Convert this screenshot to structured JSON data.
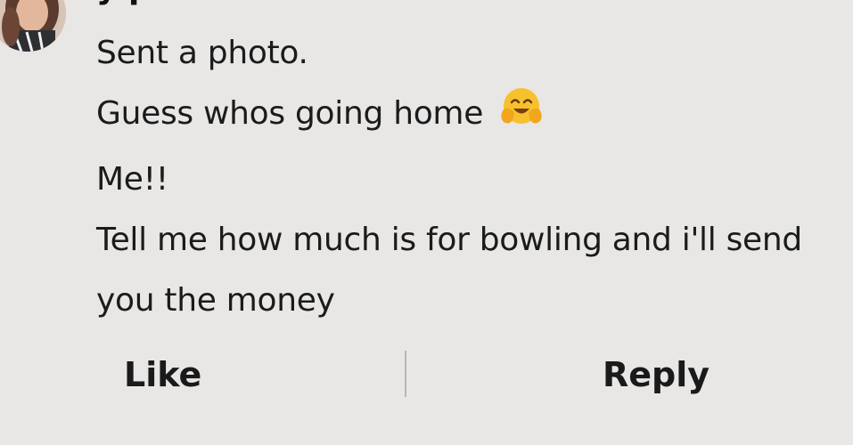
{
  "conversation": {
    "sender_name_visible": "y   p",
    "messages": [
      {
        "text": "Sent a photo."
      },
      {
        "text": "Guess whos going home",
        "emoji": "hugging-face-emoji"
      },
      {
        "text": "Me!!"
      },
      {
        "text": "Tell me how much is for bowling and i'll send you the money"
      }
    ]
  },
  "actions": {
    "like_label": "Like",
    "reply_label": "Reply"
  },
  "colors": {
    "background": "#e8e7e6",
    "text": "#1b1b1b",
    "divider": "#b9b8b7",
    "emoji": "#f7c12e"
  }
}
